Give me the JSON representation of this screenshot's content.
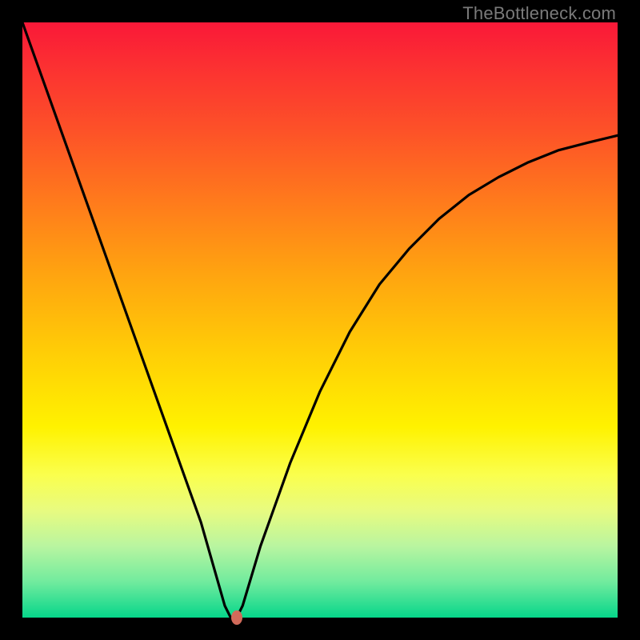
{
  "watermark": "TheBottleneck.com",
  "chart_data": {
    "type": "line",
    "title": "",
    "xlabel": "",
    "ylabel": "",
    "xlim": [
      0,
      100
    ],
    "ylim": [
      0,
      100
    ],
    "series": [
      {
        "name": "curve",
        "x": [
          0,
          5,
          10,
          15,
          20,
          25,
          30,
          34,
          35,
          36,
          37,
          40,
          45,
          50,
          55,
          60,
          65,
          70,
          75,
          80,
          85,
          90,
          95,
          100
        ],
        "values": [
          100,
          86,
          72,
          58,
          44,
          30,
          16,
          2,
          0,
          0,
          2,
          12,
          26,
          38,
          48,
          56,
          62,
          67,
          71,
          74,
          76.5,
          78.5,
          79.8,
          81
        ]
      }
    ],
    "marker": {
      "x": 36,
      "y": 0,
      "color": "#d16a5a"
    },
    "background": {
      "gradient_top": "#fa1838",
      "gradient_bottom": "#06d68a"
    }
  }
}
